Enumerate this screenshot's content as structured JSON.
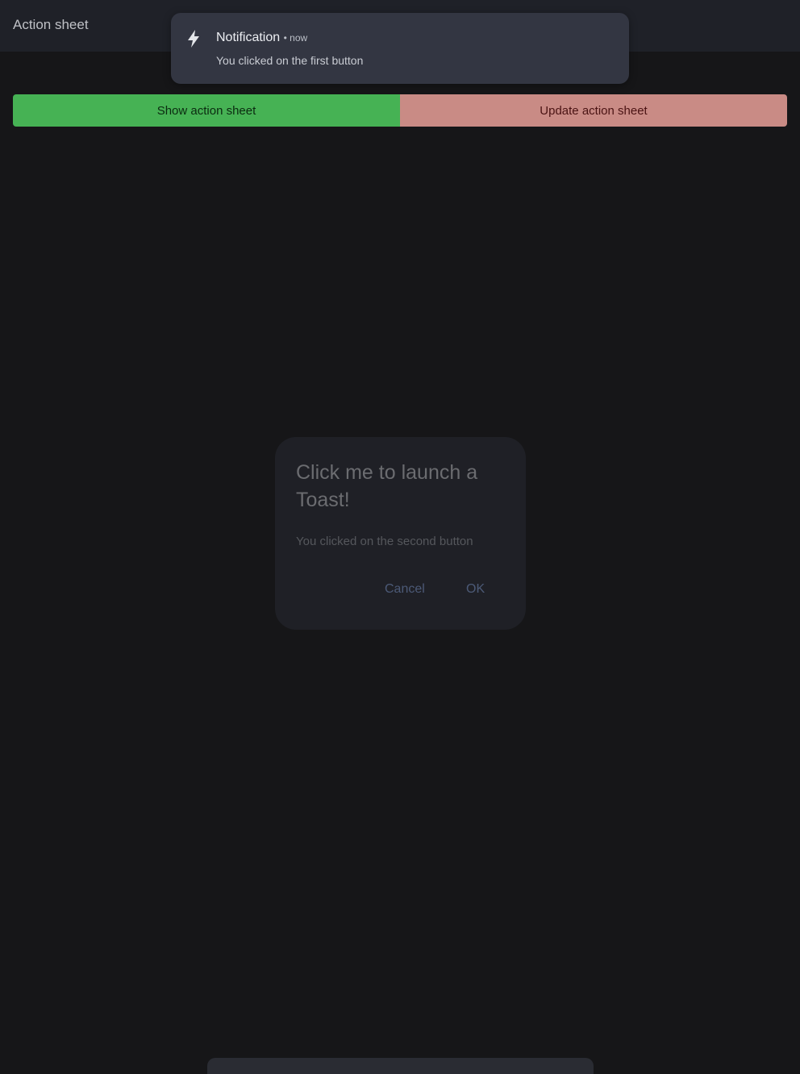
{
  "app_bar": {
    "title": "Action sheet"
  },
  "buttons": {
    "show_label": "Show action sheet",
    "update_label": "Update action sheet"
  },
  "toast": {
    "title": "Notification",
    "time": "• now",
    "message": "You clicked on the first button",
    "icon": "bolt-icon"
  },
  "dialog": {
    "title": "Click me to launch a Toast!",
    "message": "You clicked on the second button",
    "cancel_label": "Cancel",
    "ok_label": "OK"
  },
  "colors": {
    "background": "#161618",
    "app_bar": "#1f2128",
    "show_button": "#46b254",
    "update_button": "#c98b85",
    "toast": "#333642",
    "dialog": "#1f2026"
  }
}
